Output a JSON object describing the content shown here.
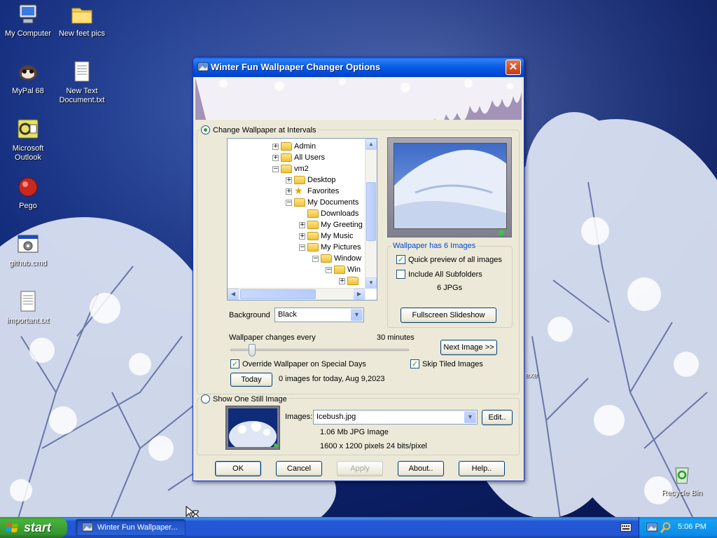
{
  "desktop": {
    "icons": [
      {
        "label": "My Computer"
      },
      {
        "label": "New feet pics"
      },
      {
        "label": "MyPal 68"
      },
      {
        "label": "New Text Document.txt"
      },
      {
        "label": "Microsoft Outlook"
      },
      {
        "label": "Pego"
      },
      {
        "label": "github.cmd"
      },
      {
        "label": "important.txt"
      },
      {
        "label": "Recycle Bin"
      }
    ],
    "partial_label": "exe"
  },
  "dialog": {
    "title": "Winter Fun Wallpaper Changer Options",
    "close_label": "✕",
    "intervals_radio": "Change Wallpaper at Intervals",
    "tree": [
      {
        "label": "Admin",
        "expander": "+"
      },
      {
        "label": "All Users",
        "expander": "+"
      },
      {
        "label": "vm2",
        "expander": "−"
      },
      {
        "label": "Desktop",
        "expander": "+"
      },
      {
        "label": "Favorites",
        "expander": "+"
      },
      {
        "label": "My Documents",
        "expander": "−"
      },
      {
        "label": "Downloads",
        "expander": ""
      },
      {
        "label": "My Greeting",
        "expander": "+"
      },
      {
        "label": "My Music",
        "expander": "+"
      },
      {
        "label": "My Pictures",
        "expander": "−"
      },
      {
        "label": "Window",
        "expander": "−"
      },
      {
        "label": "Win",
        "expander": "−"
      },
      {
        "label": "",
        "expander": "+"
      }
    ],
    "wallpaper_group_title": "Wallpaper has 6 Images",
    "quick_preview": "Quick preview of all images",
    "include_subfolders": "Include All Subfolders",
    "jpg_count": "6 JPGs",
    "fullscreen_button": "Fullscreen Slideshow",
    "background_label": "Background",
    "background_value": "Black",
    "changes_every_label": "Wallpaper changes every",
    "interval_value": "30 minutes",
    "interval_slider_level": 0.12,
    "next_image_button": "Next Image >>",
    "override_special_days": "Override Wallpaper on Special Days",
    "skip_tiled": "Skip Tiled Images",
    "today_button": "Today",
    "today_status": "0 images for today, Aug 9,2023",
    "still_image_radio": "Show One Still Image",
    "images_label": "Images:",
    "image_value": "Icebush.jpg",
    "edit_button": "Edit..",
    "image_size": "1.06 Mb  JPG Image",
    "image_dims": "1600 x 1200 pixels   24 bits/pixel",
    "ok_button": "OK",
    "cancel_button": "Cancel",
    "apply_button": "Apply",
    "about_button": "About..",
    "help_button": "Help.."
  },
  "taskbar": {
    "start_label": "start",
    "task_label": "Winter Fun Wallpaper...",
    "clock": "5:06 PM"
  },
  "colors": {
    "titlebar": "#0a5fe6",
    "taskbar": "#2456d2",
    "start": "#3c9b35",
    "tray": "#0e8be8",
    "dialog_bg": "#ece9d8"
  }
}
